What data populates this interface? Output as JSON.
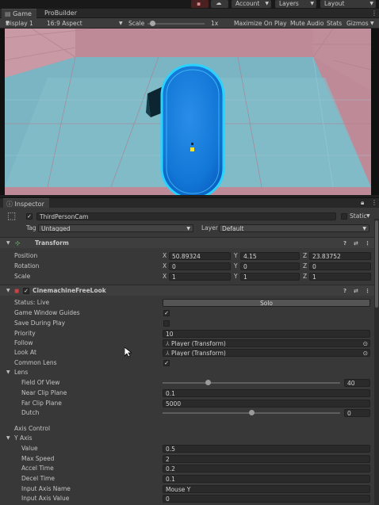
{
  "toolbar": {
    "account": "Account",
    "layers": "Layers",
    "layout": "Layout"
  },
  "game": {
    "tabs": [
      "Game",
      "ProBuilder"
    ],
    "display": "Display 1",
    "aspect": "16:9 Aspect",
    "scale_label": "Scale",
    "scale_value": "1x",
    "scale_level": 0.05,
    "maximize": "Maximize On Play",
    "mute": "Mute Audio",
    "stats": "Stats",
    "gizmos": "Gizmos"
  },
  "inspector": {
    "tab": "Inspector",
    "object_name": "ThirdPersonCam",
    "static_label": "Static",
    "tag_label": "Tag",
    "tag_value": "Untagged",
    "layer_label": "Layer",
    "layer_value": "Default"
  },
  "transform": {
    "title": "Transform",
    "rows": [
      {
        "label": "Position",
        "x": "50.89324",
        "y": "4.15",
        "z": "23.83752"
      },
      {
        "label": "Rotation",
        "x": "0",
        "y": "0",
        "z": "0"
      },
      {
        "label": "Scale",
        "x": "1",
        "y": "1",
        "z": "1"
      }
    ],
    "axes": [
      "X",
      "Y",
      "Z"
    ]
  },
  "cinemachine": {
    "title": "CinemachineFreeLook",
    "status": "Status: Live",
    "solo": "Solo",
    "game_window_guides": "Game Window Guides",
    "save_during_play": "Save During Play",
    "priority_label": "Priority",
    "priority_value": "10",
    "follow_label": "Follow",
    "follow_value": "Player (Transform)",
    "lookat_label": "Look At",
    "lookat_value": "Player (Transform)",
    "common_lens": "Common Lens",
    "lens": "Lens",
    "fov_label": "Field Of View",
    "fov_value": "40",
    "fov_level": 0.25,
    "near_label": "Near Clip Plane",
    "near_value": "0.1",
    "far_label": "Far Clip Plane",
    "far_value": "5000",
    "dutch_label": "Dutch",
    "dutch_value": "0",
    "dutch_level": 0.5,
    "axis_control": "Axis Control",
    "y_axis": "Y Axis",
    "value_label": "Value",
    "value_value": "0.5",
    "maxspeed_label": "Max Speed",
    "maxspeed_value": "2",
    "accel_label": "Accel Time",
    "accel_value": "0.2",
    "decel_label": "Decel Time",
    "decel_value": "0.1",
    "inputname_label": "Input Axis Name",
    "inputname_value": "Mouse Y",
    "inputvalue_label": "Input Axis Value",
    "inputvalue_value": "0"
  },
  "colors": {
    "accent": "#1fa0ff",
    "panel": "#383838"
  }
}
